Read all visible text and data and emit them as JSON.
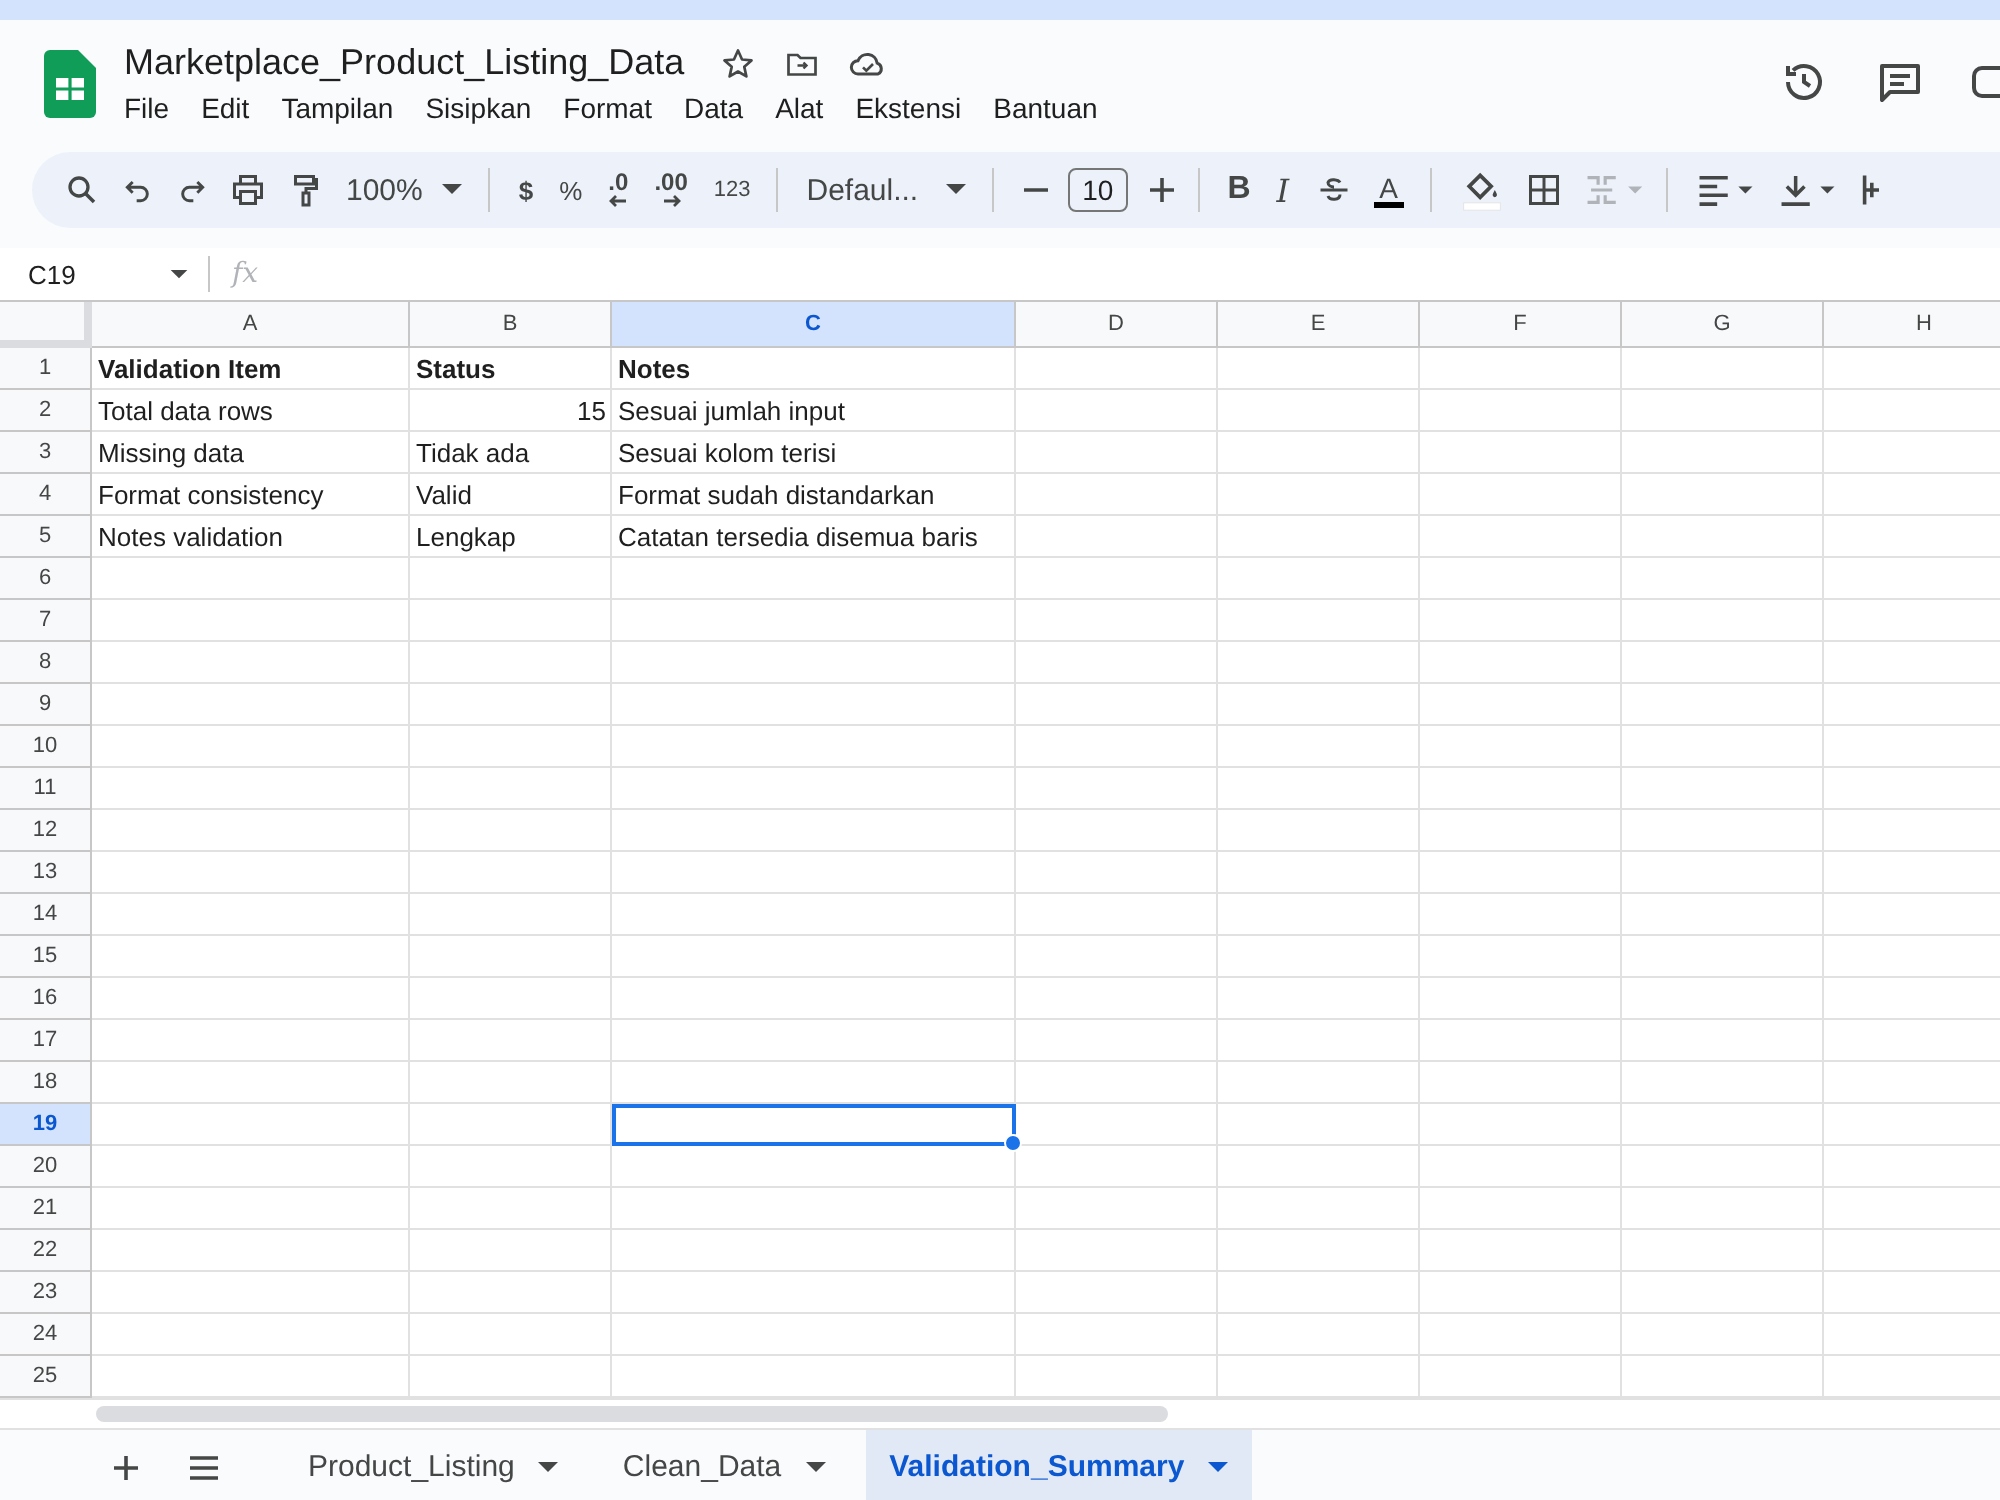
{
  "document": {
    "title": "Marketplace_Product_Listing_Data"
  },
  "menu": [
    "File",
    "Edit",
    "Tampilan",
    "Sisipkan",
    "Format",
    "Data",
    "Alat",
    "Ekstensi",
    "Bantuan"
  ],
  "toolbar": {
    "zoom": "100%",
    "currency": "$",
    "percent": "%",
    "decrease_decimal": ".0",
    "increase_decimal": ".00",
    "number_format": "123",
    "font": "Defaul...",
    "font_size": "10",
    "bold": "B",
    "italic": "I",
    "text_color": "A"
  },
  "formula_bar": {
    "name_box": "C19",
    "fx": "fx"
  },
  "columns": [
    {
      "label": "A",
      "selected": false
    },
    {
      "label": "B",
      "selected": false
    },
    {
      "label": "C",
      "selected": true
    },
    {
      "label": "D",
      "selected": false
    },
    {
      "label": "E",
      "selected": false
    },
    {
      "label": "F",
      "selected": false
    },
    {
      "label": "G",
      "selected": false
    },
    {
      "label": "H",
      "selected": false
    }
  ],
  "rows": [
    {
      "number": "1",
      "selected": false,
      "bold": true,
      "cells": [
        {
          "text": "Validation Item",
          "kind": "text"
        },
        {
          "text": "Status",
          "kind": "text"
        },
        {
          "text": "Notes",
          "kind": "text"
        }
      ]
    },
    {
      "number": "2",
      "selected": false,
      "bold": false,
      "cells": [
        {
          "text": "Total data rows",
          "kind": "text"
        },
        {
          "text": "15",
          "kind": "number"
        },
        {
          "text": "Sesuai jumlah input",
          "kind": "text"
        }
      ]
    },
    {
      "number": "3",
      "selected": false,
      "bold": false,
      "cells": [
        {
          "text": "Missing data",
          "kind": "text"
        },
        {
          "text": "Tidak ada",
          "kind": "text"
        },
        {
          "text": "Sesuai kolom terisi",
          "kind": "text"
        }
      ]
    },
    {
      "number": "4",
      "selected": false,
      "bold": false,
      "cells": [
        {
          "text": "Format consistency",
          "kind": "text"
        },
        {
          "text": "Valid",
          "kind": "text"
        },
        {
          "text": "Format sudah distandarkan",
          "kind": "text"
        }
      ]
    },
    {
      "number": "5",
      "selected": false,
      "bold": false,
      "cells": [
        {
          "text": "Notes validation",
          "kind": "text"
        },
        {
          "text": "Lengkap",
          "kind": "text"
        },
        {
          "text": "Catatan tersedia disemua baris",
          "kind": "text"
        }
      ]
    },
    {
      "number": "6",
      "selected": false
    },
    {
      "number": "7",
      "selected": false
    },
    {
      "number": "8",
      "selected": false
    },
    {
      "number": "9",
      "selected": false
    },
    {
      "number": "10",
      "selected": false
    },
    {
      "number": "11",
      "selected": false
    },
    {
      "number": "12",
      "selected": false
    },
    {
      "number": "13",
      "selected": false
    },
    {
      "number": "14",
      "selected": false
    },
    {
      "number": "15",
      "selected": false
    },
    {
      "number": "16",
      "selected": false
    },
    {
      "number": "17",
      "selected": false
    },
    {
      "number": "18",
      "selected": false
    },
    {
      "number": "19",
      "selected": true
    },
    {
      "number": "20",
      "selected": false
    },
    {
      "number": "21",
      "selected": false
    },
    {
      "number": "22",
      "selected": false
    },
    {
      "number": "23",
      "selected": false
    },
    {
      "number": "24",
      "selected": false
    },
    {
      "number": "25",
      "selected": false
    }
  ],
  "sheet_tabs": [
    {
      "label": "Product_Listing",
      "selected": false
    },
    {
      "label": "Clean_Data",
      "selected": false
    },
    {
      "label": "Validation_Summary",
      "selected": true
    }
  ]
}
